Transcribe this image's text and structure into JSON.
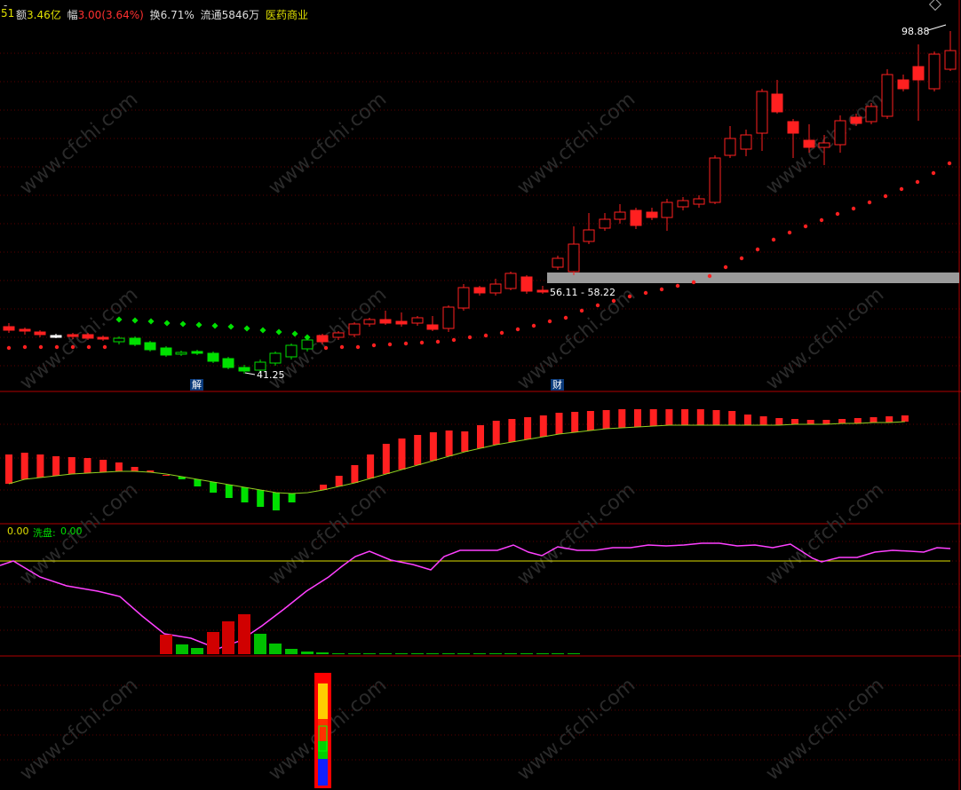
{
  "header": {
    "minus_sign": "-",
    "code_frag": "51",
    "amount_label": "额",
    "amount_value": "3.46亿",
    "change_label": "幅",
    "change_value": "3.00(3.64%)",
    "turnover_label": "换",
    "turnover_value": "6.71%",
    "float_label": "流通",
    "float_value": "5846万",
    "sector": "医药商业"
  },
  "price_panel": {
    "high_label": "98.88",
    "low_label": "41.25",
    "band_label": "56.11 - 58.22",
    "tag_jie": "解",
    "tag_cai": "财"
  },
  "indicator_panel": {
    "left_label": "0.00",
    "wash_label": "洗盘:",
    "wash_value": "0.00"
  },
  "watermark": "www.cfchi.com",
  "colors": {
    "up": "#ff2020",
    "down": "#00e000",
    "panel_border": "#b00000",
    "grid": "#5a0000",
    "magenta": "#ff40ff",
    "yellow": "#e0e000",
    "band": "#9a9a9a"
  }
}
